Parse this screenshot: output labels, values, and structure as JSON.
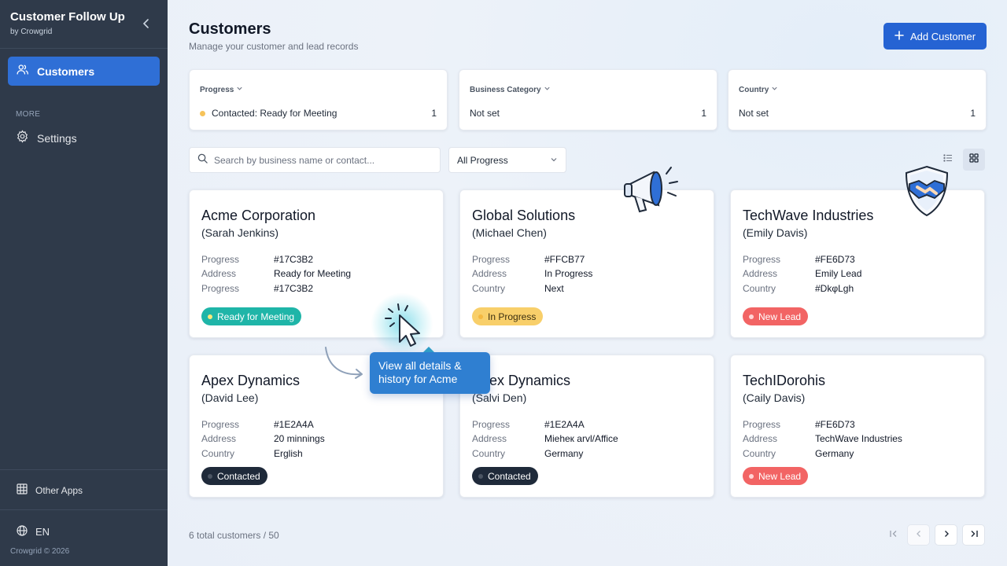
{
  "sidebar": {
    "app_title": "Customer Follow Up",
    "app_subtitle": "by Crowgrid",
    "nav_customers": "Customers",
    "more_label": "MORE",
    "nav_settings": "Settings",
    "other_apps": "Other Apps",
    "language": "EN",
    "copyright": "Crowgrid © 2026"
  },
  "header": {
    "title": "Customers",
    "subtitle": "Manage your customer and lead records",
    "add_button": "Add Customer"
  },
  "filters": [
    {
      "label": "Progress",
      "value": "Contacted: Ready for Meeting",
      "count": "1"
    },
    {
      "label": "Business Category",
      "value": "Not set",
      "count": "1"
    },
    {
      "label": "Country",
      "value": "Not set",
      "count": "1"
    }
  ],
  "search": {
    "placeholder": "Search by business name or contact..."
  },
  "progress_select": {
    "value": "All Progress"
  },
  "cards": [
    {
      "name": "Acme Corporation",
      "contact": "(Sarah Jenkins)",
      "fields": [
        [
          "Progress",
          "#17C3B2"
        ],
        [
          "Address",
          "Ready for Meeting"
        ],
        [
          "Progress",
          "#17C3B2"
        ]
      ],
      "badge": "Ready for Meeting",
      "badge_color": "#1FB5A8"
    },
    {
      "name": "Global Solutions",
      "contact": "(Michael Chen)",
      "fields": [
        [
          "Progress",
          "#FFCB77"
        ],
        [
          "Address",
          "In Progress"
        ],
        [
          "Country",
          "Next"
        ]
      ],
      "badge": "In Progress",
      "badge_color": "#F8CF6A"
    },
    {
      "name": "TechWave Industries",
      "contact": "(Emily Davis)",
      "fields": [
        [
          "Progress",
          "#FE6D73"
        ],
        [
          "Address",
          "Emily Lead"
        ],
        [
          "Country",
          "#DkφLgh"
        ]
      ],
      "badge": "New Lead",
      "badge_color": "#F26464"
    },
    {
      "name": "Apex Dynamics",
      "contact": "(David Lee)",
      "fields": [
        [
          "Progress",
          "#1E2A4A"
        ],
        [
          "Address",
          "20 minnings"
        ],
        [
          "Country",
          "Erglish"
        ]
      ],
      "badge": "Contacted",
      "badge_color": "#1F2A3A"
    },
    {
      "name": "Apex Dynamics",
      "contact": "(Salvi Den)",
      "fields": [
        [
          "Progress",
          "#1E2A4A"
        ],
        [
          "Address",
          "Mieheк arvl/Affice"
        ],
        [
          "Country",
          "Germany"
        ]
      ],
      "badge": "Contacted",
      "badge_color": "#1F2A3A"
    },
    {
      "name": "TechIDorohis",
      "contact": "(Caily Davis)",
      "fields": [
        [
          "Progress",
          "#FE6D73"
        ],
        [
          "Address",
          "TechWave Industries"
        ],
        [
          "Country",
          "Germany"
        ]
      ],
      "badge": "New Lead",
      "badge_color": "#F26464"
    }
  ],
  "tooltip": {
    "text_line1": "View all details &",
    "text_line2": "history for Acme"
  },
  "footer": {
    "total": "6 total customers / 50"
  },
  "icons": {
    "collapse": "chevron-left-icon",
    "customers": "users-icon",
    "settings": "gear-icon",
    "other_apps": "grid-icon",
    "language": "globe-icon",
    "search": "search-icon",
    "list_view": "list-icon",
    "grid_view": "grid-icon"
  },
  "colors": {
    "sidebar": "#2F3A4A",
    "accent": "#2563D3",
    "tooltip": "#2F7FD1"
  }
}
